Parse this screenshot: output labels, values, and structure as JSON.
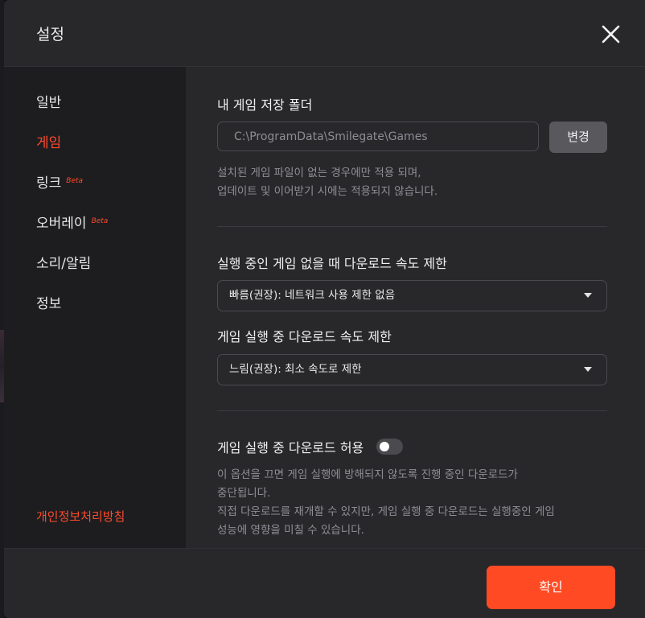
{
  "dialog": {
    "title": "설정"
  },
  "sidebar": {
    "items": [
      {
        "label": "일반",
        "active": false,
        "beta": ""
      },
      {
        "label": "게임",
        "active": true,
        "beta": ""
      },
      {
        "label": "링크",
        "active": false,
        "beta": "Beta"
      },
      {
        "label": "오버레이",
        "active": false,
        "beta": "Beta"
      },
      {
        "label": "소리/알림",
        "active": false,
        "beta": ""
      },
      {
        "label": "정보",
        "active": false,
        "beta": ""
      }
    ],
    "privacy_link": "개인정보처리방침"
  },
  "game": {
    "folder_heading": "내 게임 저장 폴더",
    "folder_path": "C:\\ProgramData\\Smilegate\\Games",
    "change_button": "변경",
    "folder_note_1": "설치된 게임 파일이 없는 경우에만 적용 되며,",
    "folder_note_2": "업데이트 및 이어받기 시에는 적용되지 않습니다.",
    "idle_limit_heading": "실행 중인 게임 없을 때 다운로드 속도 제한",
    "idle_limit_value": "빠름(권장): 네트워크 사용 제한 없음",
    "running_limit_heading": "게임 실행 중 다운로드 속도 제한",
    "running_limit_value": "느림(권장): 최소 속도로 제한",
    "allow_download_heading": "게임 실행 중 다운로드 허용",
    "allow_download_enabled": false,
    "allow_note_1": "이 옵션을 끄면 게임 실행에 방해되지 않도록 진행 중인 다운로드가",
    "allow_note_2": "중단됩니다.",
    "allow_note_3": "직접 다운로드를 재개할 수 있지만, 게임 실행 중 다운로드는 실행중인 게임",
    "allow_note_4": "성능에 영향을 미칠 수 있습니다."
  },
  "footer": {
    "confirm_button": "확인"
  },
  "colors": {
    "accent": "#ff4a23",
    "panel": "#28282b",
    "sidebar": "#1d1d20"
  },
  "icons": {
    "close": "close-icon",
    "dropdown": "chevron-down-icon"
  }
}
